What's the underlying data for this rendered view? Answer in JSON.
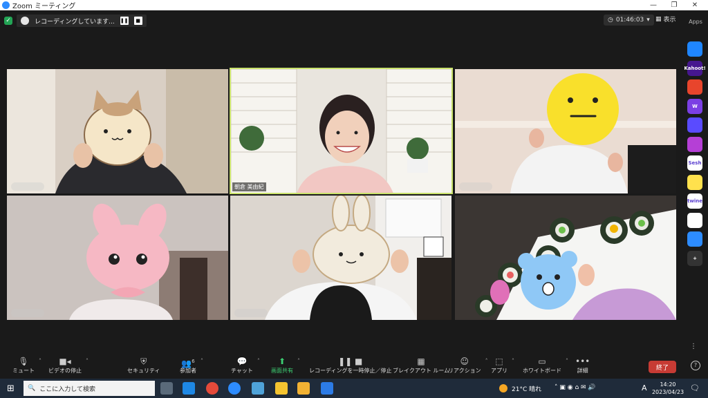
{
  "window": {
    "title": "Zoom ミーティング",
    "controls": [
      "—",
      "❐",
      "✕"
    ]
  },
  "recording": {
    "text": "レコーディングしています...",
    "pause_icon": "❚❚",
    "stop_icon": "■"
  },
  "timer": {
    "value": "01:46:03",
    "caret": "▾"
  },
  "view": {
    "label": "表示"
  },
  "tiles": [
    {
      "label": ""
    },
    {
      "label": "朝倉 美由紀"
    },
    {
      "label": ""
    },
    {
      "label": ""
    },
    {
      "label": ""
    },
    {
      "label": ""
    }
  ],
  "apps": {
    "label": "Apps",
    "items": [
      "",
      "Kahoot!",
      "",
      "W",
      "",
      "",
      "Sesh",
      "",
      "twine",
      "",
      "",
      "+"
    ],
    "colors": [
      "#1f86ff",
      "#46178f",
      "#e8452c",
      "#7b3fe4",
      "#5a4bff",
      "#b53fd6",
      "#ffffff",
      "#ffe14d",
      "#ffffff",
      "#ffffff",
      "#2d8cff",
      "#333333"
    ]
  },
  "toolbar": {
    "mute": "ミュート",
    "video": "ビデオの停止",
    "security": "セキュリティ",
    "participants": "参加者",
    "participants_count": "6",
    "chat": "チャット",
    "share": "画面共有",
    "recording": "レコーディングを一時停止／停止",
    "breakout": "ブレイクアウト ルーム",
    "reactions": "リアクション",
    "apps": "アプリ",
    "whiteboard": "ホワイトボード",
    "more": "詳細",
    "end": "終了"
  },
  "taskbar": {
    "search_placeholder": "ここに入力して検索",
    "weather": "21°C 晴れ",
    "time": "14:20",
    "date": "2023/04/23",
    "ime": "A"
  },
  "colors": {
    "accent_green": "#23a455",
    "speaker_border": "#c9e26b",
    "end_red": "#c73b34",
    "taskbar": "#1f2b3a"
  }
}
